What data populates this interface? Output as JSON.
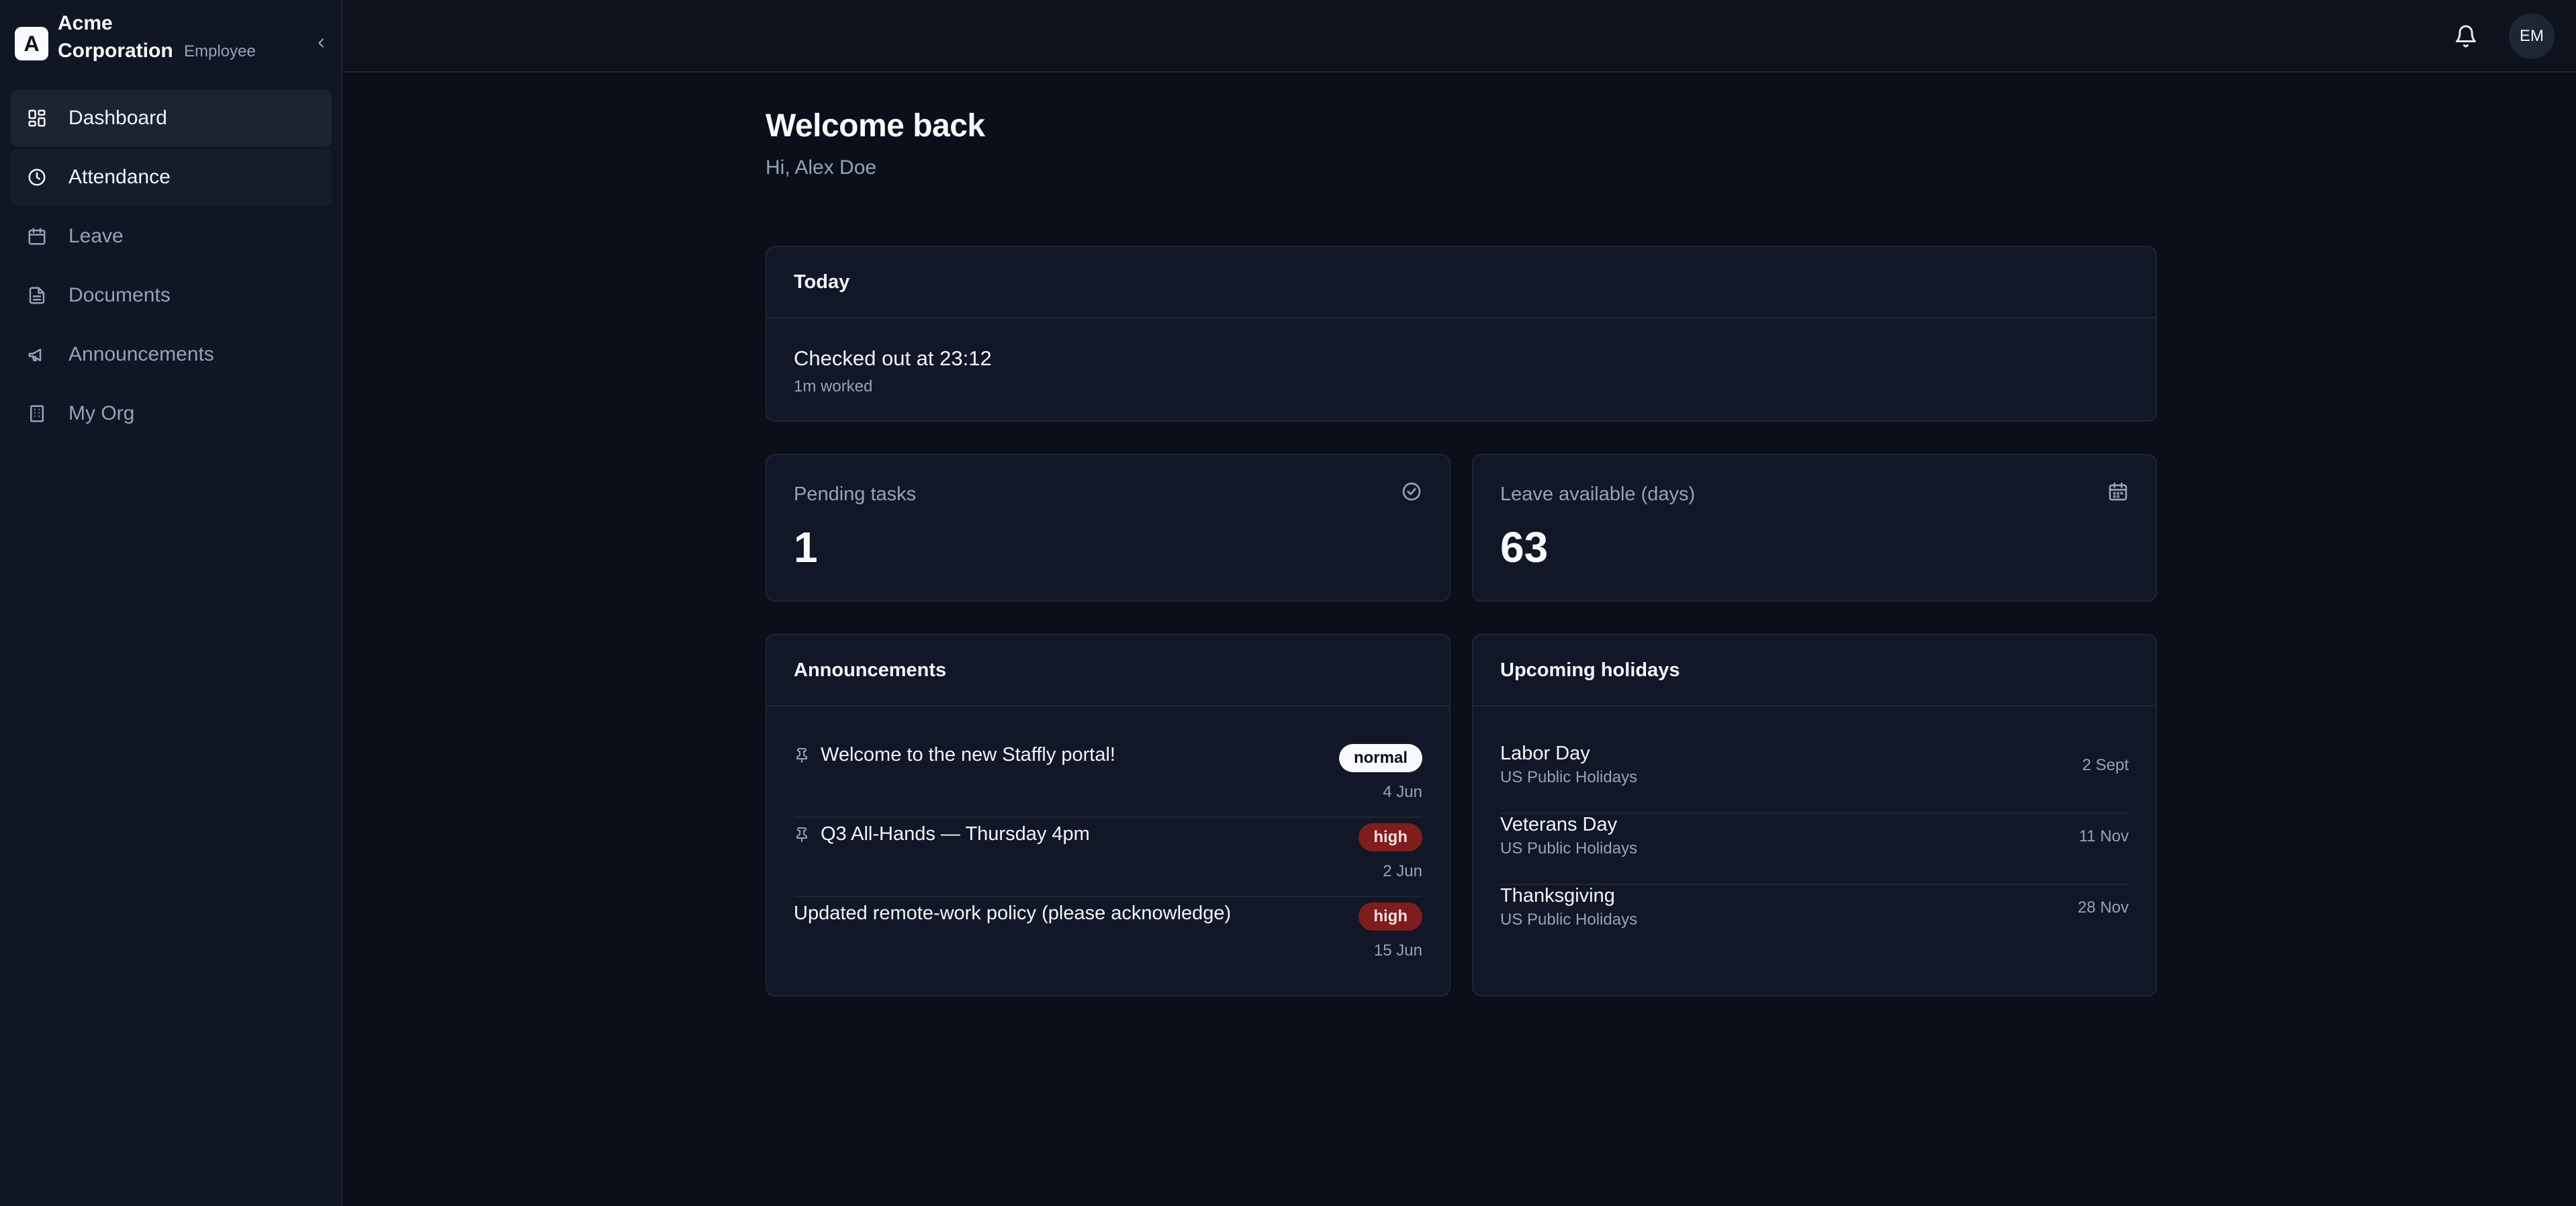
{
  "brand": {
    "logo_letter": "A",
    "name": "Acme Corporation",
    "role": "Employee"
  },
  "sidebar": {
    "items": [
      {
        "label": "Dashboard",
        "icon": "dashboard-icon",
        "state": "active"
      },
      {
        "label": "Attendance",
        "icon": "clock-icon",
        "state": "hover"
      },
      {
        "label": "Leave",
        "icon": "calendar-icon",
        "state": "default"
      },
      {
        "label": "Documents",
        "icon": "document-icon",
        "state": "default"
      },
      {
        "label": "Announcements",
        "icon": "megaphone-icon",
        "state": "default"
      },
      {
        "label": "My Org",
        "icon": "building-icon",
        "state": "default"
      }
    ]
  },
  "topbar": {
    "avatar_initials": "EM",
    "notifications_icon": "bell-icon"
  },
  "main": {
    "title": "Welcome back",
    "greeting": "Hi, Alex Doe"
  },
  "today": {
    "title": "Today",
    "status": "Checked out at 23:12",
    "worked": "1m worked"
  },
  "stats": {
    "pending": {
      "label": "Pending tasks",
      "value": "1",
      "icon": "check-circle-icon"
    },
    "leave": {
      "label": "Leave available (days)",
      "value": "63",
      "icon": "calendar-icon"
    }
  },
  "announcements": {
    "title": "Announcements",
    "items": [
      {
        "title": "Welcome to the new Staffly portal!",
        "pinned": true,
        "priority": "normal",
        "date": "4 Jun"
      },
      {
        "title": "Q3 All-Hands — Thursday 4pm",
        "pinned": true,
        "priority": "high",
        "date": "2 Jun"
      },
      {
        "title": "Updated remote-work policy (please acknowledge)",
        "pinned": false,
        "priority": "high",
        "date": "15 Jun"
      }
    ]
  },
  "holidays": {
    "title": "Upcoming holidays",
    "items": [
      {
        "name": "Labor Day",
        "calendar": "US Public Holidays",
        "date": "2 Sept"
      },
      {
        "name": "Veterans Day",
        "calendar": "US Public Holidays",
        "date": "11 Nov"
      },
      {
        "name": "Thanksgiving",
        "calendar": "US Public Holidays",
        "date": "28 Nov"
      }
    ]
  },
  "colors": {
    "background": "#0b0f19",
    "card": "#111726",
    "border": "#1e2533",
    "badge_high": "#7f1d1d",
    "badge_normal": "#f8fafc"
  }
}
